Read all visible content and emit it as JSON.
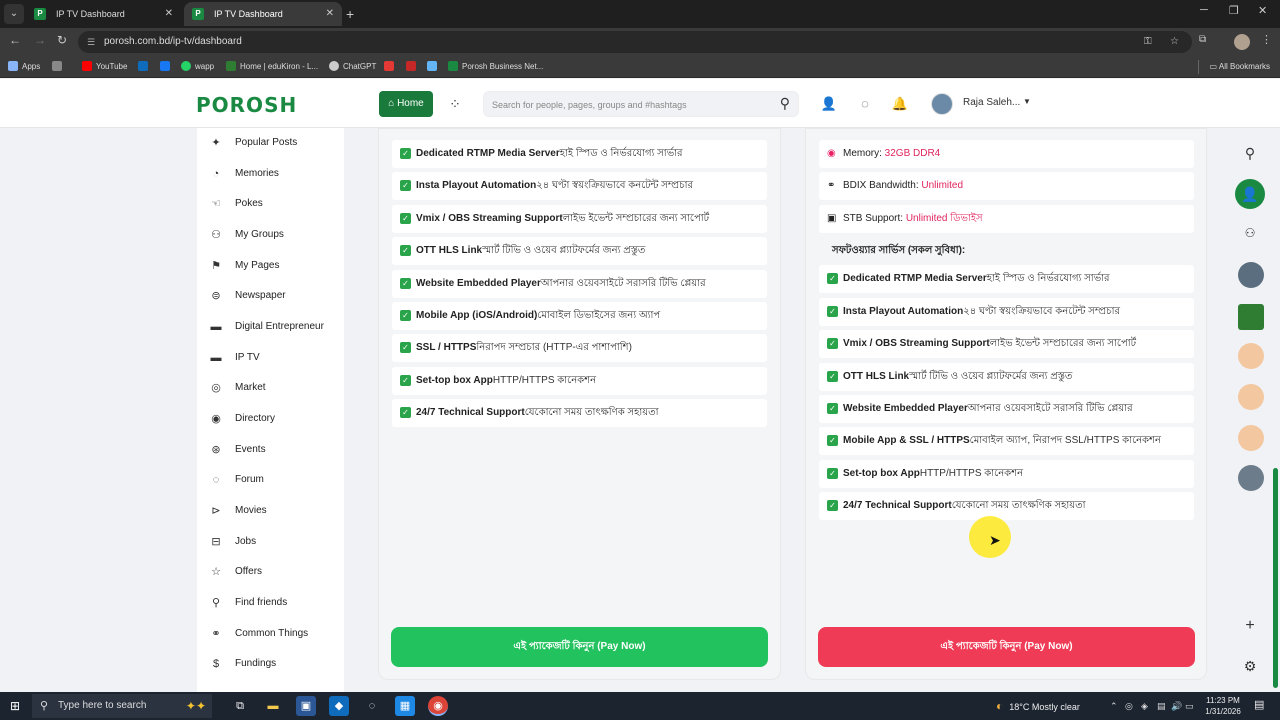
{
  "browser": {
    "tabs": [
      {
        "title": "IP TV Dashboard"
      },
      {
        "title": "IP TV Dashboard"
      }
    ],
    "url": "porosh.com.bd/ip-tv/dashboard",
    "bookmarks": [
      {
        "label": "Apps"
      },
      {
        "label": "YouTube"
      },
      {
        "label": "wapp"
      },
      {
        "label": "Home | eduKiron - L..."
      },
      {
        "label": "ChatGPT"
      },
      {
        "label": "Porosh Business Net..."
      }
    ],
    "all_bookmarks": "All Bookmarks"
  },
  "header": {
    "logo": "POROSH",
    "home_label": "Home",
    "search_placeholder": "Search for people, pages, groups and #hashtags",
    "user_name": "Raja Saleh..."
  },
  "sidebar": {
    "items": [
      {
        "label": "Popular Posts",
        "icon": "sparkle-icon"
      },
      {
        "label": "Memories",
        "icon": "memories-icon"
      },
      {
        "label": "Pokes",
        "icon": "poke-icon"
      },
      {
        "label": "My Groups",
        "icon": "groups-icon"
      },
      {
        "label": "My Pages",
        "icon": "flag-icon"
      },
      {
        "label": "Newspaper",
        "icon": "newspaper-icon"
      },
      {
        "label": "Digital Entrepreneur",
        "icon": "monitor-icon"
      },
      {
        "label": "IP TV",
        "icon": "tv-icon"
      },
      {
        "label": "Market",
        "icon": "market-icon"
      },
      {
        "label": "Directory",
        "icon": "compass-icon"
      },
      {
        "label": "Events",
        "icon": "events-icon"
      },
      {
        "label": "Forum",
        "icon": "forum-icon"
      },
      {
        "label": "Movies",
        "icon": "movies-icon"
      },
      {
        "label": "Jobs",
        "icon": "jobs-icon"
      },
      {
        "label": "Offers",
        "icon": "star-icon"
      },
      {
        "label": "Find friends",
        "icon": "add-user-icon"
      },
      {
        "label": "Common Things",
        "icon": "link-icon"
      },
      {
        "label": "Fundings",
        "icon": "dollar-icon"
      }
    ]
  },
  "package_left": {
    "features": [
      {
        "name": "Dedicated RTMP Media Server",
        "desc": "হাই স্পিড ও নির্ভরযোগ্য সার্ভার"
      },
      {
        "name": "Insta Playout Automation",
        "desc": "২৪ ঘণ্টা স্বয়ংক্রিয়ভাবে কনটেন্ট সম্প্রচার"
      },
      {
        "name": "Vmix / OBS Streaming Support",
        "desc": "লাইভ ইভেন্ট সম্প্রচারের জন্য সাপোর্ট"
      },
      {
        "name": "OTT HLS Link",
        "desc": "স্মার্ট টিভি ও ওয়েব প্ল্যাটফর্মের জন্য প্রস্তুত"
      },
      {
        "name": "Website Embedded Player",
        "desc": "আপনার ওয়েবসাইটে সরাসরি টিভি প্লেয়ার"
      },
      {
        "name": "Mobile App (iOS/Android)",
        "desc": "মোবাইল ডিভাইসের জন্য অ্যাপ"
      },
      {
        "name": "SSL / HTTPS",
        "desc": "নিরাপদ সম্প্রচার (HTTP-এর পাশাপাশি)"
      },
      {
        "name": "Set-top box App",
        "desc": "HTTP/HTTPS কানেকশন"
      },
      {
        "name": "24/7 Technical Support",
        "desc": "যেকোনো সময় তাৎক্ষণিক সহায়তা"
      }
    ],
    "pay_label": "এই প্যাকেজটি কিনুন (Pay Now)"
  },
  "package_right": {
    "specs": [
      {
        "label": "Memory: ",
        "value": "32GB DDR4",
        "icon": "memory-icon"
      },
      {
        "label": "BDIX Bandwidth: ",
        "value": "Unlimited",
        "icon": "bandwidth-icon"
      },
      {
        "label": "STB Support: ",
        "value": "Unlimited ডিভাইস",
        "icon": "stb-icon"
      }
    ],
    "software_heading": "সফটওয়্যার সার্ভিস (সকল সুবিধা):",
    "features": [
      {
        "name": "Dedicated RTMP Media Server",
        "desc": "হাই স্পিড ও নির্ভরযোগ্য সার্ভার"
      },
      {
        "name": "Insta Playout Automation",
        "desc": "২৪ ঘণ্টা স্বয়ংক্রিয়ভাবে কনটেন্ট সম্প্রচার"
      },
      {
        "name": "Vmix / OBS Streaming Support",
        "desc": "লাইভ ইভেন্ট সম্প্রচারের জন্য সাপোর্ট"
      },
      {
        "name": "OTT HLS Link",
        "desc": "স্মার্ট টিভি ও ওয়েব প্ল্যাটফর্মের জন্য প্রস্তুত"
      },
      {
        "name": "Website Embedded Player",
        "desc": "আপনার ওয়েবসাইটে সরাসরি টিভি প্লেয়ার"
      },
      {
        "name": "Mobile App & SSL / HTTPS",
        "desc": "মোবাইল অ্যাপ, নিরাপদ SSL/HTTPS কানেকশন"
      },
      {
        "name": "Set-top box App",
        "desc": "HTTP/HTTPS কানেকশন"
      },
      {
        "name": "24/7 Technical Support",
        "desc": "যেকোনো সময় তাৎক্ষণিক সহায়তা"
      }
    ],
    "pay_label": "এই প্যাকেজটি কিনুন (Pay Now)"
  },
  "taskbar": {
    "search_placeholder": "Type here to search",
    "weather": "18°C  Mostly clear",
    "time": "11:23 PM",
    "date": "1/31/2026"
  },
  "colors": {
    "brand_green": "#1a8a42",
    "pay_green": "#22c25e",
    "pay_red": "#ef3b55",
    "accent_red": "#e0245e"
  }
}
